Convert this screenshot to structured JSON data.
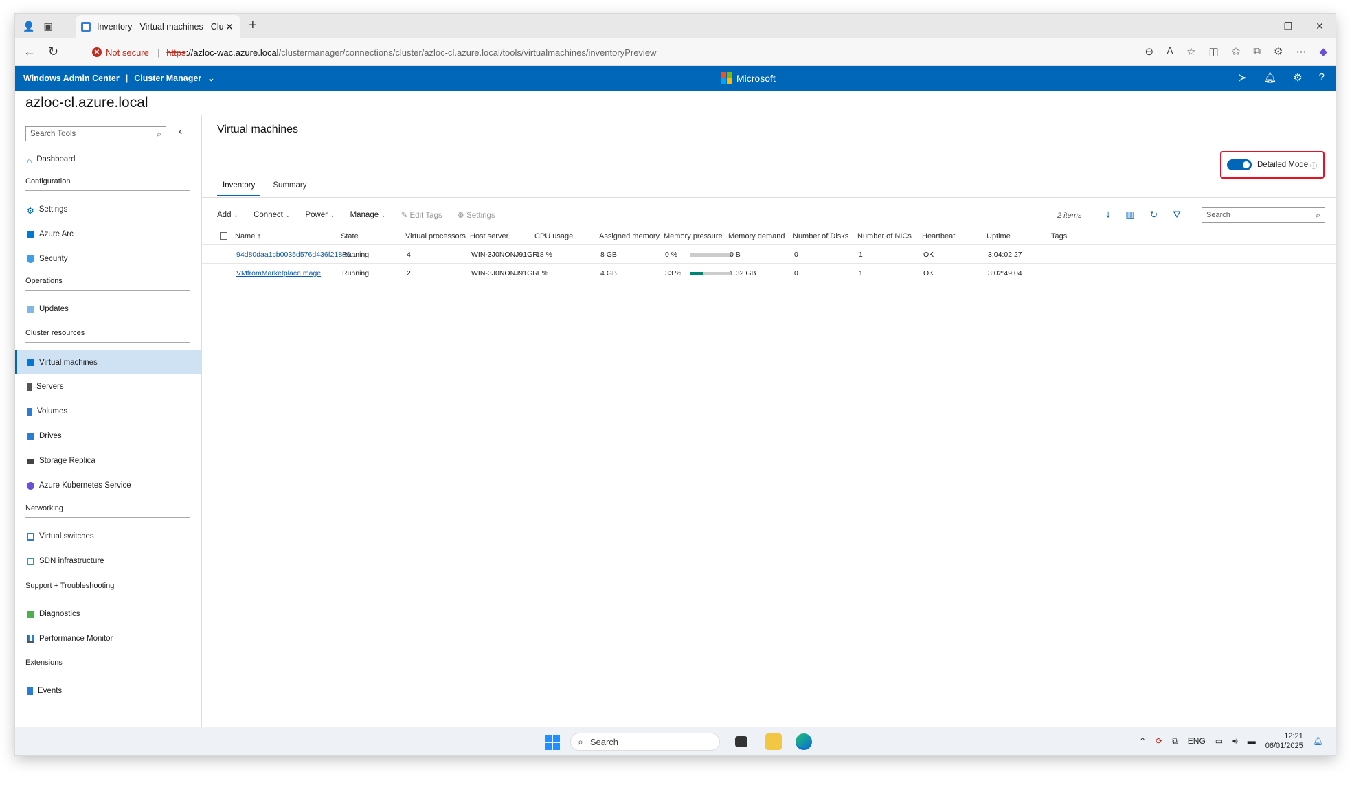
{
  "browser": {
    "tab_title": "Inventory - Virtual machines - Clu",
    "not_secure": "Not secure",
    "url_scheme": "https",
    "url_host": "://azloc-wac.azure.local",
    "url_path": "/clustermanager/connections/cluster/azloc-cl.azure.local/tools/virtualmachines/inventoryPreview"
  },
  "header": {
    "app": "Windows Admin Center",
    "section": "Cluster Manager",
    "brand": "Microsoft",
    "brand_colors": [
      "#f25022",
      "#7fba00",
      "#00a4ef",
      "#ffb900"
    ]
  },
  "context_title": "azloc-cl.azure.local",
  "sidebar": {
    "search_placeholder": "Search Tools",
    "dashboard": "Dashboard",
    "sections": {
      "configuration": "Configuration",
      "operations": "Operations",
      "cluster_resources": "Cluster resources",
      "networking": "Networking",
      "support": "Support + Troubleshooting",
      "extensions": "Extensions"
    },
    "items": {
      "settings": "Settings",
      "azure_arc": "Azure Arc",
      "security": "Security",
      "updates": "Updates",
      "virtual_machines": "Virtual machines",
      "servers": "Servers",
      "volumes": "Volumes",
      "drives": "Drives",
      "storage_replica": "Storage Replica",
      "aks": "Azure Kubernetes Service",
      "virtual_switches": "Virtual switches",
      "sdn": "SDN infrastructure",
      "diagnostics": "Diagnostics",
      "perfmon": "Performance Monitor",
      "events": "Events"
    }
  },
  "main": {
    "title": "Virtual machines",
    "detailed_mode": "Detailed Mode",
    "detailed_mode_on": true,
    "tabs": [
      "Inventory",
      "Summary"
    ],
    "toolbar": {
      "add": "Add",
      "connect": "Connect",
      "power": "Power",
      "manage": "Manage",
      "edit_tags": "Edit Tags",
      "settings": "Settings"
    },
    "item_count": "2 items",
    "search_placeholder": "Search",
    "columns": [
      "Name",
      "State",
      "Virtual processors",
      "Host server",
      "CPU usage",
      "Assigned memory",
      "Memory pressure",
      "Memory demand",
      "Number of Disks",
      "Number of NICs",
      "Heartbeat",
      "Uptime",
      "Tags"
    ],
    "rows": [
      {
        "name": "94d80daa1cb0035d576d436f218e6...",
        "state": "Running",
        "vp": "4",
        "host": "WIN-3J0NONJ91GR",
        "cpu": "18 %",
        "mem": "8 GB",
        "pressure": "0 %",
        "pressure_value": 0,
        "demand": "0 B",
        "disks": "0",
        "nics": "1",
        "heartbeat": "OK",
        "uptime": "3:04:02:27"
      },
      {
        "name": "VMfromMarketplaceImage",
        "state": "Running",
        "vp": "2",
        "host": "WIN-3J0NONJ91GR",
        "cpu": "1 %",
        "mem": "4 GB",
        "pressure": "33 %",
        "pressure_value": 33,
        "demand": "1.32 GB",
        "disks": "0",
        "nics": "1",
        "heartbeat": "OK",
        "uptime": "3:02:49:04"
      }
    ]
  },
  "taskbar": {
    "search": "Search",
    "lang": "ENG",
    "time": "12:21",
    "date": "06/01/2025"
  }
}
